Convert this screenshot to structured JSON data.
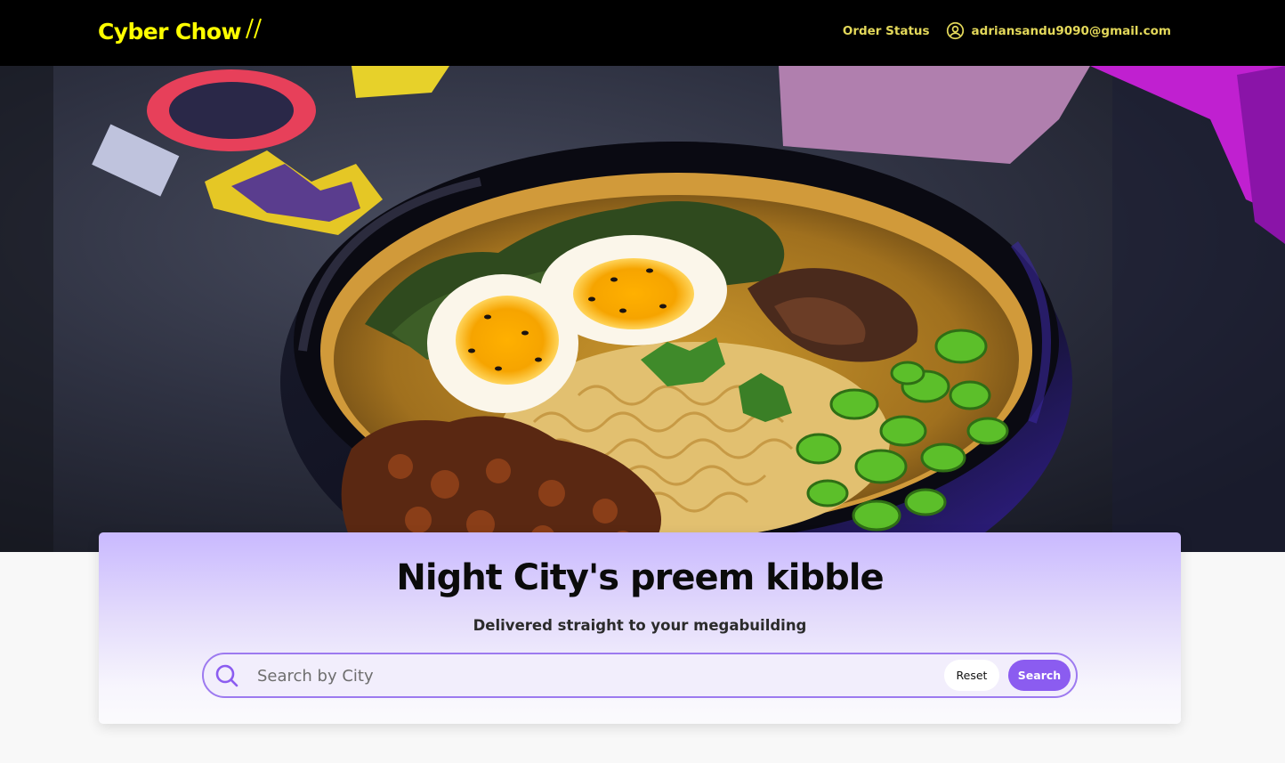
{
  "header": {
    "logo_text": "Cyber Chow",
    "order_status_label": "Order Status",
    "user_email": "adriansandu9090@gmail.com"
  },
  "hero": {
    "image_description_icon": "ramen-bowl-image"
  },
  "search_card": {
    "headline": "Night City's preem kibble",
    "subheadline": "Delivered straight to your megabuilding",
    "search_placeholder": "Search by City",
    "search_value": "",
    "reset_label": "Reset",
    "search_label": "Search"
  },
  "colors": {
    "header_bg": "#000000",
    "logo": "#ffff00",
    "nav_text": "#e3d85a",
    "accent": "#8b5cf0",
    "search_border": "#9d7af0"
  }
}
